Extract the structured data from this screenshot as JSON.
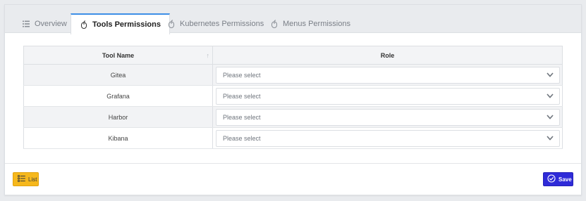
{
  "tabs": [
    {
      "label": "Overview",
      "active": false,
      "icon": "list-icon"
    },
    {
      "label": "Tools Permissions",
      "active": true,
      "icon": "mouse-icon"
    },
    {
      "label": "Kubernetes Permissions",
      "active": false,
      "icon": "mouse-icon"
    },
    {
      "label": "Menus Permissions",
      "active": false,
      "icon": "mouse-icon"
    }
  ],
  "table": {
    "columns": [
      "Tool Name",
      "Role"
    ],
    "sort_icon": "sort-ascending-icon",
    "rows": [
      {
        "tool": "Gitea",
        "role_placeholder": "Please select"
      },
      {
        "tool": "Grafana",
        "role_placeholder": "Please select"
      },
      {
        "tool": "Harbor",
        "role_placeholder": "Please select"
      },
      {
        "tool": "Kibana",
        "role_placeholder": "Please select"
      }
    ]
  },
  "footer": {
    "list_label": "List",
    "save_label": "Save"
  },
  "colors": {
    "accent_tab": "#3d8ee6",
    "list_button": "#f6b81c",
    "save_button": "#2f2bd8"
  }
}
